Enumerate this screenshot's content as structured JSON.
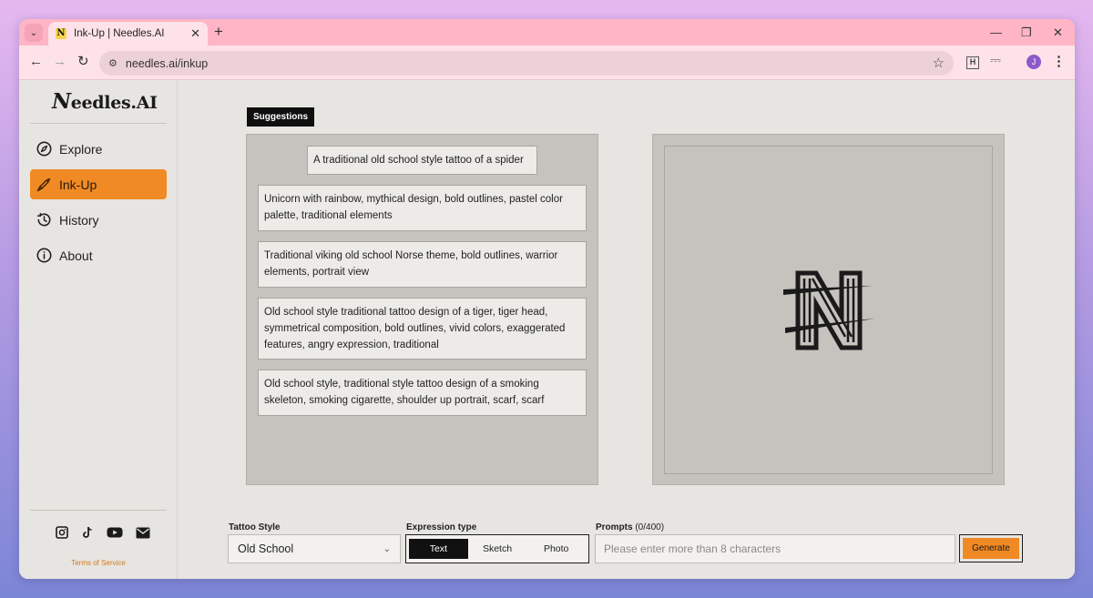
{
  "browser": {
    "tab_title": "Ink-Up | Needles.AI",
    "favicon_letter": "N",
    "url": "needles.ai/inkup",
    "profile_initial": "J",
    "extension_letter": "H"
  },
  "sidebar": {
    "logo": {
      "initial": "N",
      "rest": "eedles.AI"
    },
    "items": [
      {
        "label": "Explore",
        "icon": "compass-icon",
        "active": false
      },
      {
        "label": "Ink-Up",
        "icon": "needle-icon",
        "active": true
      },
      {
        "label": "History",
        "icon": "history-icon",
        "active": false
      },
      {
        "label": "About",
        "icon": "info-icon",
        "active": false
      }
    ],
    "social": [
      "instagram-icon",
      "tiktok-icon",
      "youtube-icon",
      "mail-icon"
    ],
    "terms": "Terms of Service"
  },
  "suggestions": {
    "tag": "Suggestions",
    "items": [
      "A traditional old school style tattoo of a spider",
      "Unicorn with rainbow, mythical design, bold outlines, pastel color palette, traditional elements",
      "Traditional viking old school Norse theme, bold outlines, warrior elements, portrait view",
      "Old school style traditional tattoo design of a tiger, tiger head, symmetrical composition, bold outlines, vivid colors, exaggerated features, angry expression, traditional",
      "Old school style, traditional style tattoo design of a smoking skeleton, smoking cigarette, shoulder up portrait, scarf, scarf"
    ]
  },
  "controls": {
    "tattoo_style_label": "Tattoo Style",
    "tattoo_style_value": "Old School",
    "expression_label": "Expression type",
    "expression_options": [
      "Text",
      "Sketch",
      "Photo"
    ],
    "expression_selected": "Text",
    "prompts_label": "Prompts",
    "prompts_count": "(0/400)",
    "prompt_placeholder": "Please enter more than 8 characters",
    "generate_label": "Generate"
  },
  "colors": {
    "accent": "#f08a24",
    "tab_strip": "#ffb5c5",
    "panel": "#c6c3be",
    "page_bg": "#e7e5e1"
  }
}
